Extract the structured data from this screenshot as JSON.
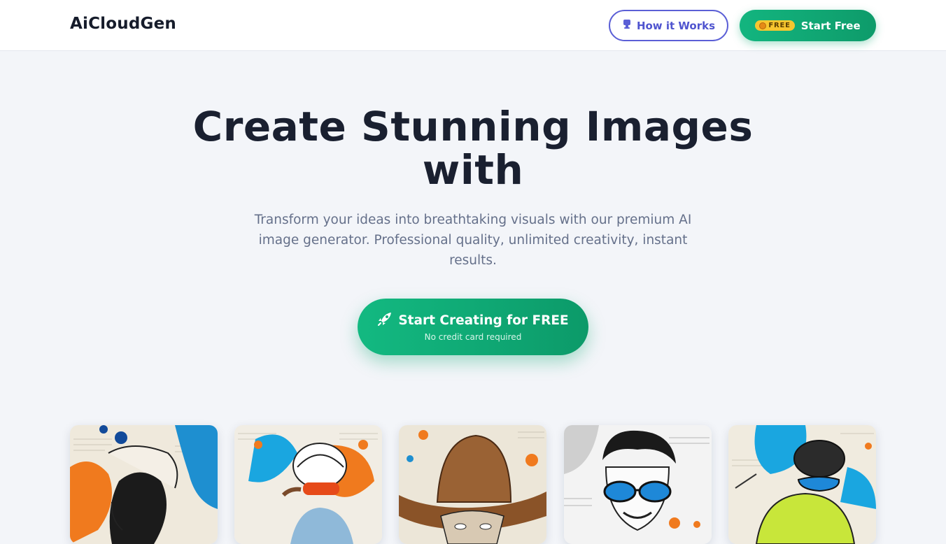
{
  "header": {
    "logo": "AiCloudGen",
    "how_it_works": "How it Works",
    "free_badge": "FREE",
    "start_free": "Start Free"
  },
  "hero": {
    "title_line1": "Create Stunning Images",
    "title_line2": "with",
    "subtitle": "Transform your ideas into breathtaking visuals with our premium AI image generator. Professional quality, unlimited creativity, instant results.",
    "cta_label": "Start Creating for FREE",
    "cta_note": "No credit card required"
  },
  "icons": {
    "how_it_works": "video-camera-icon",
    "free_badge": "coin-icon",
    "cta": "rocket-icon"
  },
  "gallery": [
    {
      "subject": "woman-with-raised-arm-splash-art"
    },
    {
      "subject": "female-cyclist-helmet-splash-art"
    },
    {
      "subject": "cowboy-hat-portrait"
    },
    {
      "subject": "man-with-sunglasses-sketch"
    },
    {
      "subject": "cyclist-green-jersey-splash-art"
    }
  ],
  "colors": {
    "brand_green": "#10b07a",
    "accent_indigo": "#5b5fd6",
    "title": "#1a2030",
    "subtitle": "#65708a",
    "background": "#f3f5f9"
  }
}
